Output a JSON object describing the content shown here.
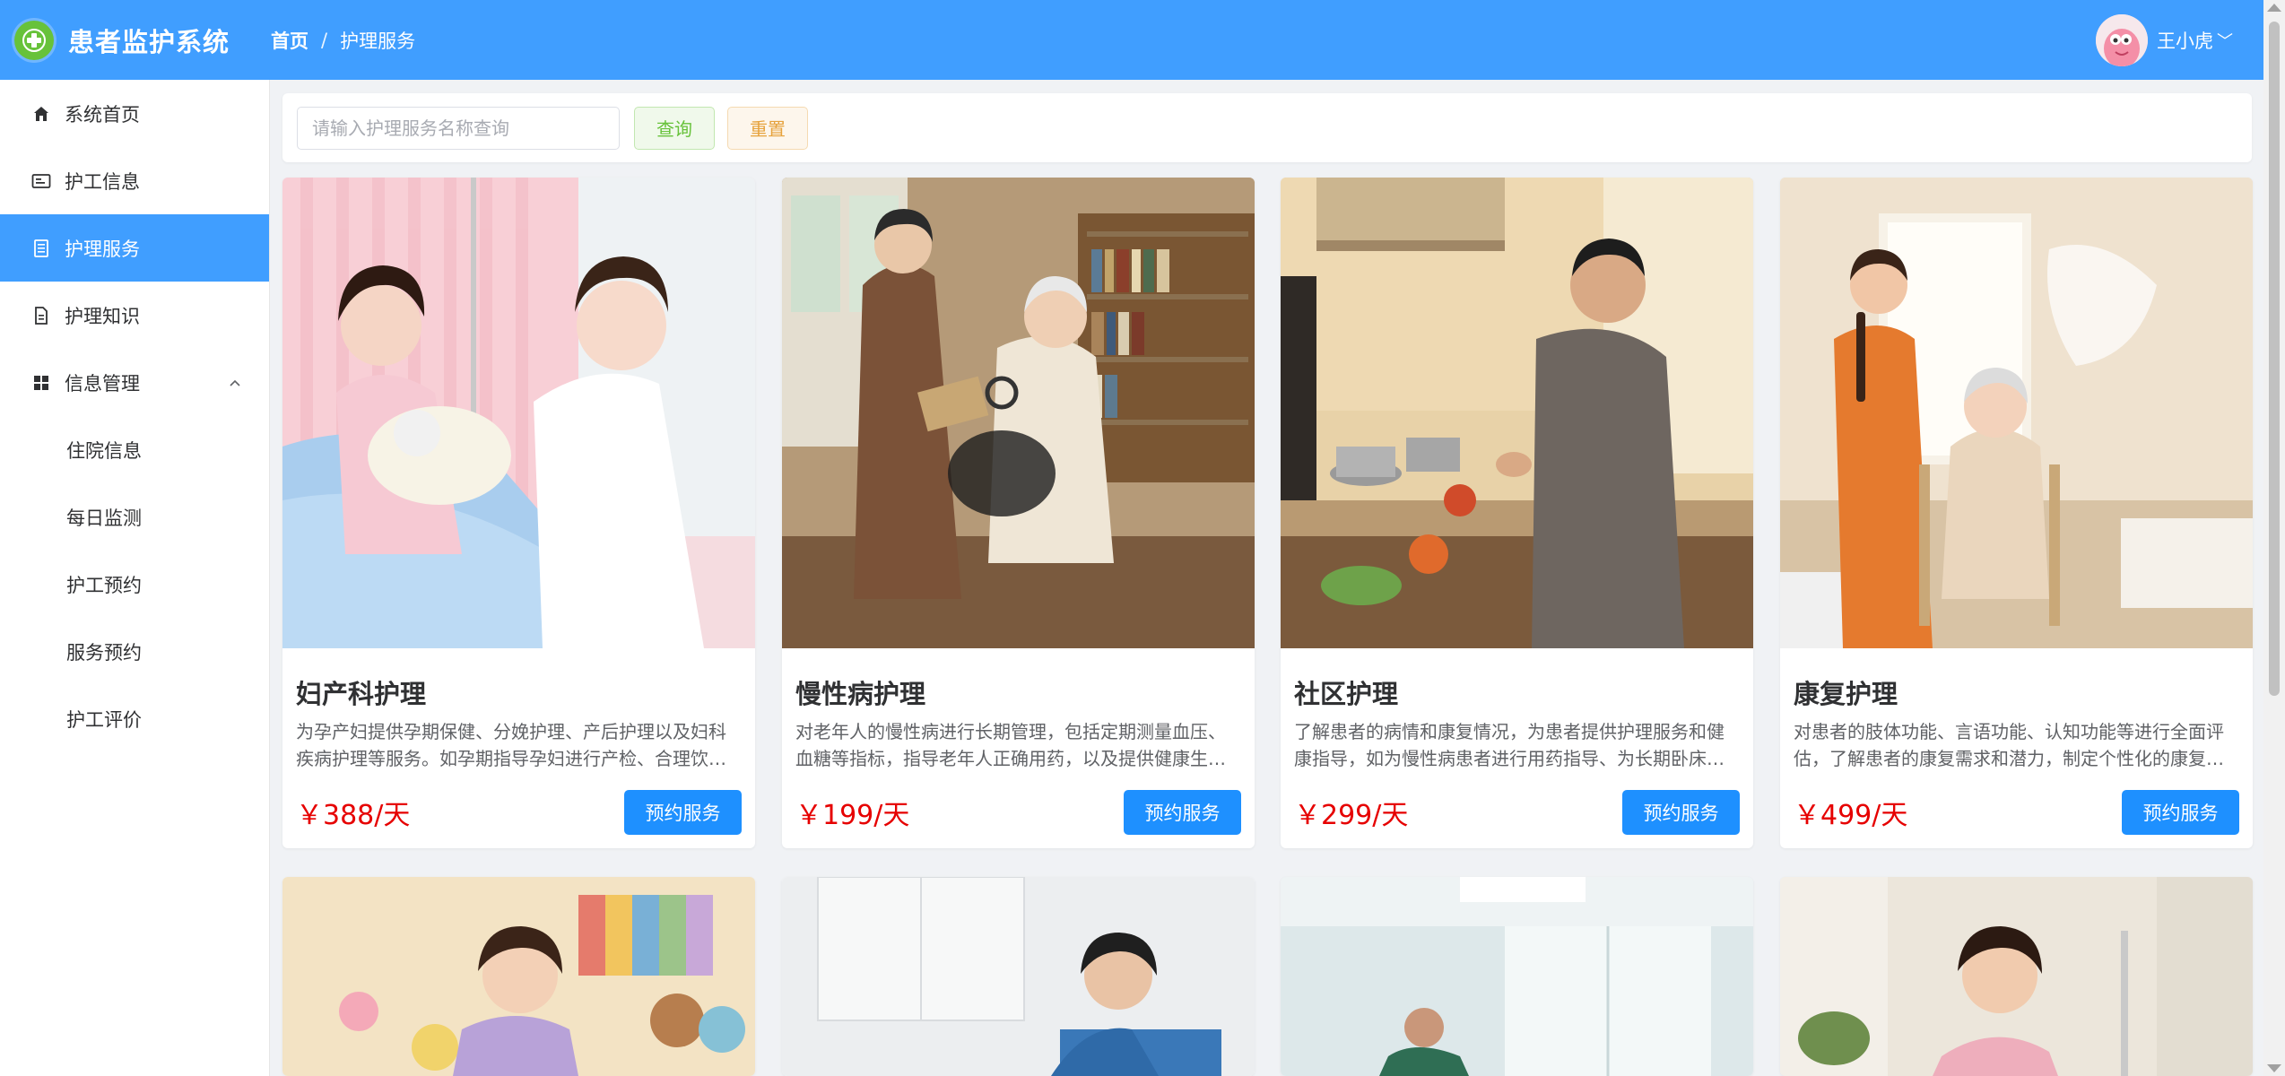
{
  "header": {
    "app_title": "患者监护系统",
    "breadcrumb": [
      "首页",
      "护理服务"
    ],
    "breadcrumb_sep": "/",
    "username": "王小虎",
    "caret": "﹀"
  },
  "sidebar": {
    "items": [
      {
        "label": "系统首页",
        "icon": "home-icon"
      },
      {
        "label": "护工信息",
        "icon": "id-card-icon"
      },
      {
        "label": "护理服务",
        "icon": "document-icon",
        "active": true
      },
      {
        "label": "护理知识",
        "icon": "file-icon"
      },
      {
        "label": "信息管理",
        "icon": "grid-icon",
        "expanded": true
      },
      {
        "label": "住院信息",
        "sub": true
      },
      {
        "label": "每日监测",
        "sub": true
      },
      {
        "label": "护工预约",
        "sub": true
      },
      {
        "label": "服务预约",
        "sub": true
      },
      {
        "label": "护工评价",
        "sub": true
      }
    ]
  },
  "search": {
    "placeholder": "请输入护理服务名称查询",
    "query_label": "查询",
    "reset_label": "重置"
  },
  "cards": [
    {
      "title": "妇产科护理",
      "desc": "为孕产妇提供孕期保健、分娩护理、产后护理以及妇科疾病护理等服务。如孕期指导孕妇进行产检、合理饮食与适度运动。",
      "price": "￥388/天",
      "button": "预约服务"
    },
    {
      "title": "慢性病护理",
      "desc": "对老年人的慢性病进行长期管理，包括定期测量血压、血糖等指标，指导老年人正确用药，以及提供健康生活方式建议。",
      "price": "￥199/天",
      "button": "预约服务"
    },
    {
      "title": "社区护理",
      "desc": "了解患者的病情和康复情况，为患者提供护理服务和健康指导，如为慢性病患者进行用药指导、为长期卧床患者提供护理。",
      "price": "￥299/天",
      "button": "预约服务"
    },
    {
      "title": "康复护理",
      "desc": "对患者的肢体功能、言语功能、认知功能等进行全面评估，了解患者的康复需求和潜力，制定个性化的康复护理计划。",
      "price": "￥499/天",
      "button": "预约服务"
    }
  ],
  "colors": {
    "primary": "#409eff",
    "price": "#e60000",
    "book_button": "#1e90ff",
    "query": "#67c23a",
    "reset": "#e6a23c"
  }
}
